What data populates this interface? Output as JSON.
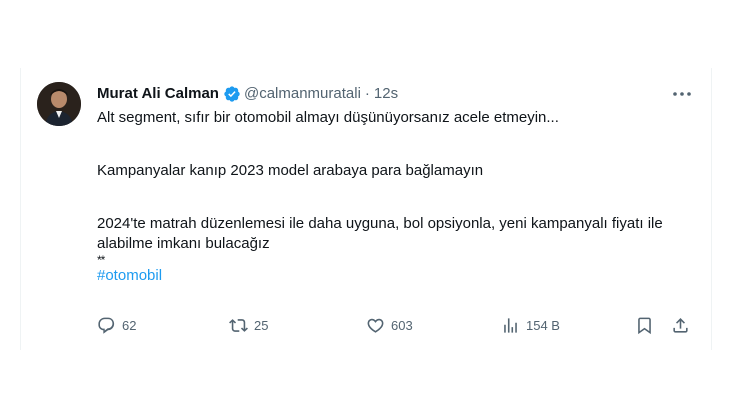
{
  "tweet": {
    "author_name": "Murat Ali Calman",
    "handle": "@calmanmuratali",
    "separator": "·",
    "time": "12s",
    "lines": [
      "Alt segment, sıfır bir otomobil almayı düşünüyorsanız acele etmeyin...",
      "Kampanyalar kanıp 2023 model arabaya para bağlamayın",
      "2024'te matrah düzenlemesi ile daha uyguna, bol opsiyonla, yeni kampanyalı fiyatı ile alabilme imkanı bulacağız"
    ],
    "stars": "**",
    "hashtag": "#otomobil",
    "stats": {
      "replies": "62",
      "reposts": "25",
      "likes": "603",
      "views": "154 B"
    }
  },
  "colors": {
    "accent": "#1d9bf0",
    "text": "#0f1419",
    "muted": "#536471"
  },
  "icons": [
    "verified-badge-icon",
    "more-icon",
    "reply-icon",
    "repost-icon",
    "like-icon",
    "views-icon",
    "bookmark-icon",
    "share-icon"
  ]
}
